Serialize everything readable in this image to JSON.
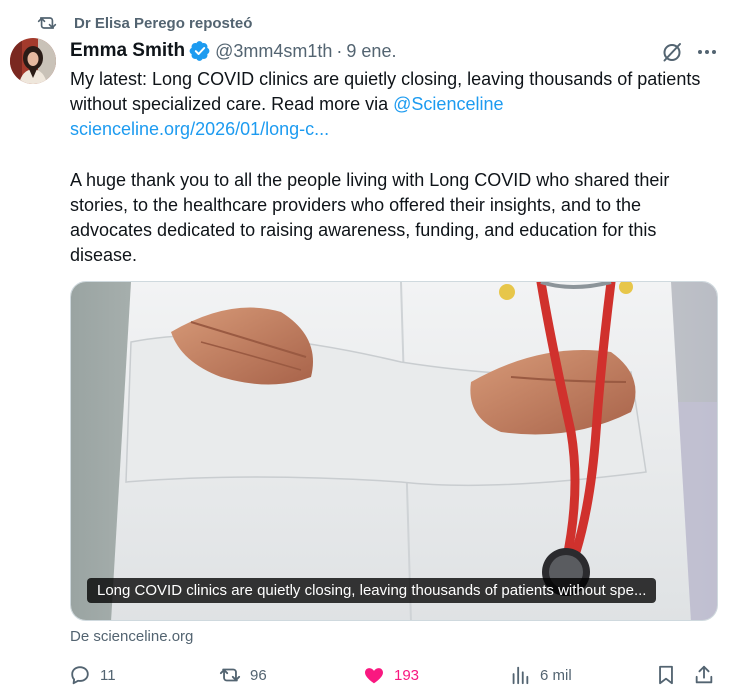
{
  "repost": {
    "label": "Dr Elisa Perego reposteó"
  },
  "tweet": {
    "author_name": "Emma Smith",
    "handle": "@3mm4sm1th",
    "separator": "·",
    "date": "9 ene.",
    "text_intro": "My latest: Long COVID clinics are quietly closing, leaving thousands of patients without specialized care. Read more via ",
    "mention": "@Scienceline",
    "url": "scienceline.org/2026/01/long-c...",
    "text_para2": "A huge thank you to all the people living with Long COVID who shared their stories, to the healthcare providers who offered their insights, and to the advocates dedicated to raising awareness, funding, and education for this disease."
  },
  "media": {
    "caption": "Long COVID clinics are quietly closing, leaving thousands of patients without spe...",
    "source": "De scienceline.org"
  },
  "actions": {
    "replies": "11",
    "reposts": "96",
    "likes": "193",
    "views": "6 mil"
  },
  "colors": {
    "accent": "#1d9bf0",
    "like": "#f91880",
    "secondary_text": "#536471"
  },
  "icons": [
    "repost-icon",
    "verified-icon",
    "grok-icon",
    "more-icon",
    "reply-icon",
    "like-icon",
    "views-icon",
    "bookmark-icon",
    "share-icon"
  ]
}
